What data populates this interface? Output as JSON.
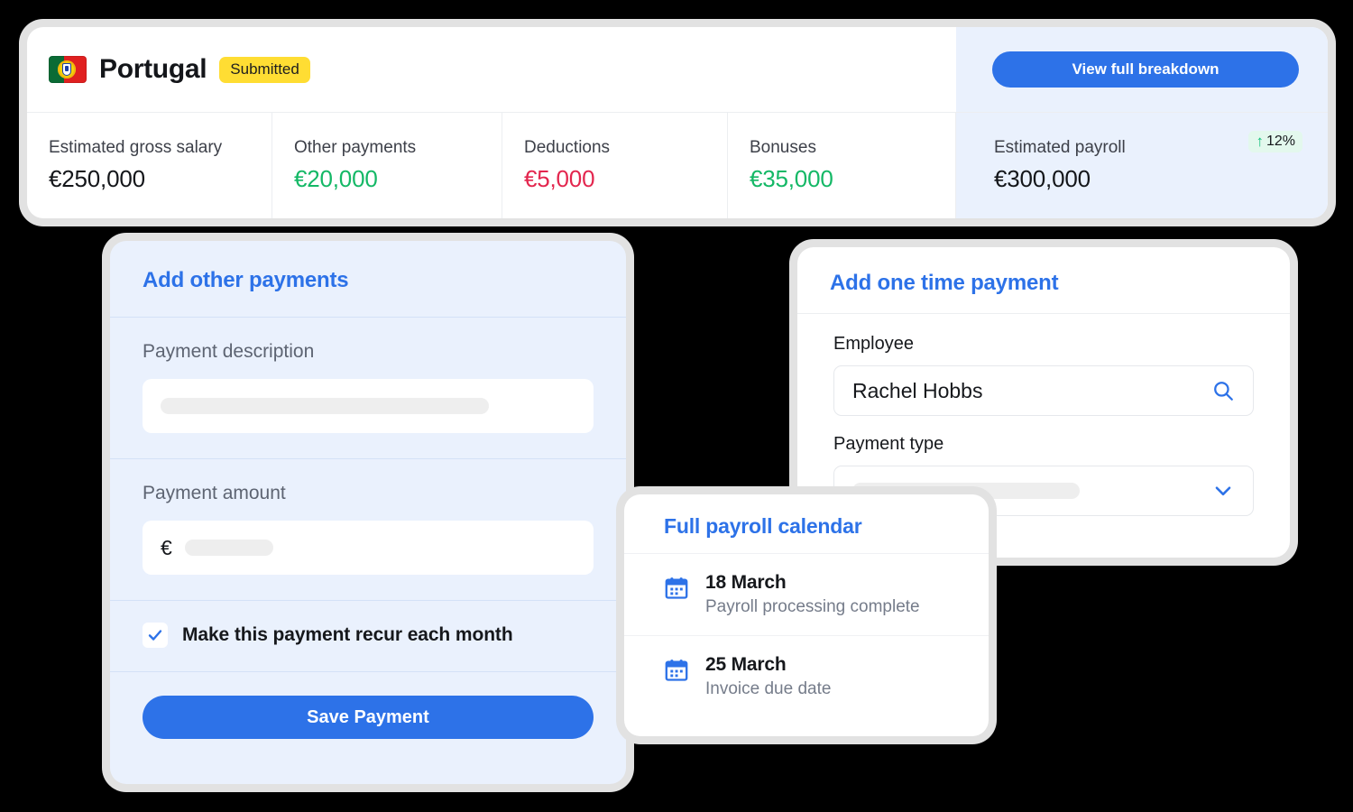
{
  "summary": {
    "country": "Portugal",
    "flag_icon": "portugal-flag-icon",
    "status": "Submitted",
    "breakdown_button": "View full breakdown",
    "stats": [
      {
        "label": "Estimated gross salary",
        "value": "€250,000",
        "tone": "neutral"
      },
      {
        "label": "Other payments",
        "value": "€20,000",
        "tone": "positive"
      },
      {
        "label": "Deductions",
        "value": "€5,000",
        "tone": "negative"
      },
      {
        "label": "Bonuses",
        "value": "€35,000",
        "tone": "positive"
      }
    ],
    "total": {
      "label": "Estimated payroll",
      "value": "€300,000",
      "trend_arrow": "↑",
      "trend_value": "12%"
    }
  },
  "other_payments": {
    "title": "Add other payments",
    "description_label": "Payment description",
    "description_value": "",
    "amount_label": "Payment amount",
    "amount_currency": "€",
    "amount_value": "",
    "recur_label": "Make this payment recur each month",
    "recur_checked": "✓",
    "save_button": "Save Payment"
  },
  "one_time_payment": {
    "title": "Add one time payment",
    "employee_label": "Employee",
    "employee_value": "Rachel Hobbs",
    "search_icon": "search-icon",
    "payment_type_label": "Payment type",
    "payment_type_value": "",
    "chevron_icon": "chevron-down-icon"
  },
  "calendar": {
    "title": "Full payroll calendar",
    "items": [
      {
        "icon": "calendar-icon",
        "date": "18 March",
        "description": "Payroll processing complete"
      },
      {
        "icon": "calendar-icon",
        "date": "25 March",
        "description": "Invoice due date"
      }
    ]
  },
  "colors": {
    "brand_blue": "#2d72e8",
    "positive_green": "#14b866",
    "negative_red": "#e3264e",
    "badge_yellow": "#ffdd33",
    "panel_blue": "#eaf1fd",
    "trend_green_bg": "#e3f8ed"
  }
}
